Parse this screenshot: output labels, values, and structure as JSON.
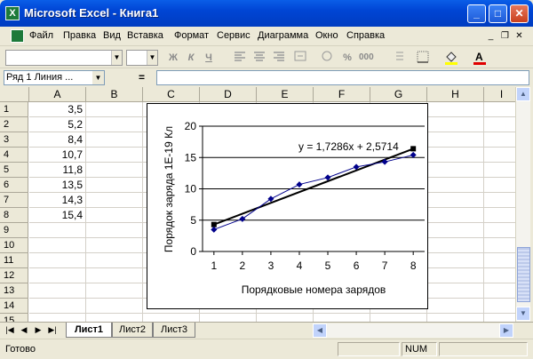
{
  "window": {
    "title": "Microsoft Excel - Книга1",
    "app_icon": "excel-icon",
    "minimize": "_",
    "maximize": "□",
    "close": "✕"
  },
  "menu": {
    "items": [
      "Файл",
      "Правка",
      "Вид",
      "Вставка",
      "Формат",
      "Сервис",
      "Диаграмма",
      "Окно",
      "Справка"
    ],
    "doc_minimize": "_",
    "doc_restore": "❐",
    "doc_close": "✕"
  },
  "toolbar": {
    "bold": "Ж",
    "italic": "К",
    "underline": "Ч",
    "percent": "%",
    "thousands": "000"
  },
  "formula_bar": {
    "name_box": "Ряд 1 Линия ...",
    "equals": "="
  },
  "grid": {
    "columns": [
      "A",
      "B",
      "C",
      "D",
      "E",
      "F",
      "G",
      "H",
      "I"
    ],
    "rows": [
      "1",
      "2",
      "3",
      "4",
      "5",
      "6",
      "7",
      "8",
      "9",
      "10",
      "11",
      "12",
      "13",
      "14",
      "15"
    ],
    "column_a_values": [
      "3,5",
      "5,2",
      "8,4",
      "10,7",
      "11,8",
      "13,5",
      "14,3",
      "15,4"
    ]
  },
  "chart_data": {
    "type": "line",
    "x": [
      1,
      2,
      3,
      4,
      5,
      6,
      7,
      8
    ],
    "series": [
      {
        "values": [
          3.5,
          5.2,
          8.4,
          10.7,
          11.8,
          13.5,
          14.3,
          15.4
        ],
        "color": "#00008b",
        "marker": "diamond"
      }
    ],
    "trendline": {
      "type": "linear",
      "slope": 1.7286,
      "intercept": 2.5714,
      "equation_label": "y = 1,7286x + 2,5714"
    },
    "xlabel": "Порядковые номера зарядов",
    "ylabel": "Порядок заряда 1Е-19 Кл",
    "x_ticks": [
      "1",
      "2",
      "3",
      "4",
      "5",
      "6",
      "7",
      "8"
    ],
    "y_ticks": [
      "0",
      "5",
      "10",
      "15",
      "20"
    ],
    "xlim": [
      1,
      8
    ],
    "ylim": [
      0,
      20
    ],
    "grid": "horizontal major gridlines"
  },
  "sheets": {
    "tabs": [
      "Лист1",
      "Лист2",
      "Лист3"
    ],
    "active": "Лист1"
  },
  "status": {
    "text": "Готово",
    "num": "NUM"
  }
}
